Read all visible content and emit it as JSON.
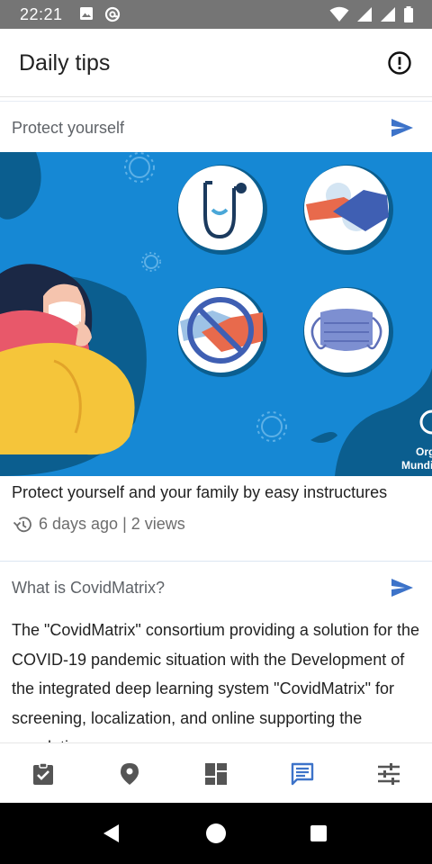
{
  "status_bar": {
    "time": "22:21",
    "left_icons": [
      "image-icon",
      "at-sign-icon"
    ],
    "right_icons": [
      "wifi-icon",
      "signal-icon",
      "signal-icon",
      "battery-icon"
    ]
  },
  "app_bar": {
    "title": "Daily tips",
    "info_icon": "info-circle-icon"
  },
  "tips": [
    {
      "title": "Protect yourself",
      "caption": "Protect yourself and your family by easy instructures",
      "meta": "6 days ago | 2 views",
      "image_watermark": [
        "Org",
        "Mundi"
      ]
    },
    {
      "title": "What is CovidMatrix?",
      "body": "The \"CovidMatrix\" consortium providing a solution for the COVID-19 pandemic situation with the Development of the integrated deep learning system \"CovidMatrix\" for screening, localization, and online supporting the population"
    }
  ],
  "bottom_nav": {
    "items": [
      "assignment-check-icon",
      "location-pin-icon",
      "dashboard-icon",
      "chat-icon",
      "tune-sliders-icon"
    ],
    "active_index": 3
  },
  "colors": {
    "accent": "#3d73c9",
    "status_bar": "#757575",
    "image_background": "#1688d4",
    "image_dark": "#0b5e8f"
  }
}
